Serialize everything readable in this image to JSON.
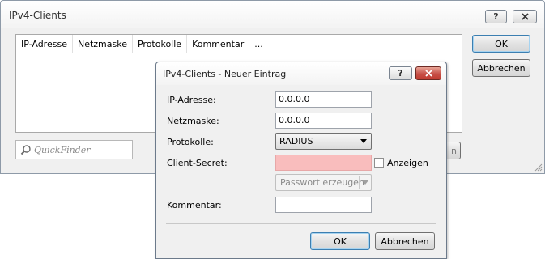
{
  "parent": {
    "title": "IPv4-Clients",
    "help_label": "?",
    "columns": [
      "IP-Adresse",
      "Netzmaske",
      "Protokolle",
      "Kommentar",
      "..."
    ],
    "quickfinder_placeholder": "QuickFinder",
    "ok_label": "OK",
    "cancel_label": "Abbrechen",
    "hidden_button_partial": "n"
  },
  "dialog": {
    "title": "IPv4-Clients - Neuer Eintrag",
    "help_label": "?",
    "fields": {
      "ip_label": "IP-Adresse:",
      "ip_value": "0.0.0.0",
      "netmask_label": "Netzmaske:",
      "netmask_value": "0.0.0.0",
      "protocol_label": "Protokolle:",
      "protocol_value": "RADIUS",
      "secret_label": "Client-Secret:",
      "secret_value": "",
      "show_label": "Anzeigen",
      "generate_label": "Passwort erzeugen",
      "comment_label": "Kommentar:",
      "comment_value": ""
    },
    "ok_label": "OK",
    "cancel_label": "Abbrechen"
  },
  "colors": {
    "window_bg": "#f0f0f0",
    "error_field": "#f9bdbd",
    "close_button": "#c75048",
    "default_button_border": "#3c7fb1"
  },
  "icons": [
    "help-icon",
    "close-icon",
    "search-icon",
    "dropdown-arrow-icon",
    "resize-grip-icon"
  ]
}
